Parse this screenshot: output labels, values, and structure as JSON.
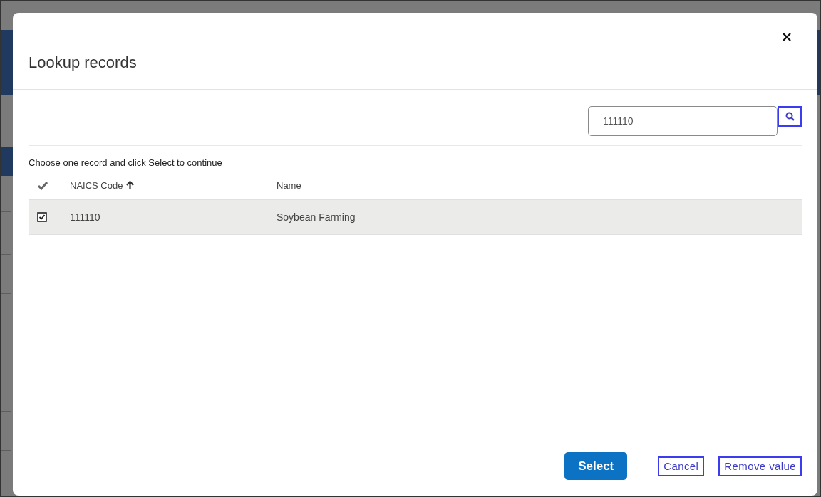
{
  "dialog": {
    "title": "Lookup records"
  },
  "search": {
    "value": "111110"
  },
  "instruction": "Choose one record and click Select to continue",
  "columns": [
    {
      "label": "NAICS Code",
      "sorted": true
    },
    {
      "label": "Name",
      "sorted": false
    }
  ],
  "rows": [
    {
      "selected": true,
      "checked": true,
      "cells": [
        "111110",
        "Soybean Farming"
      ]
    }
  ],
  "buttons": [
    {
      "label": "Select",
      "kind": "primary"
    },
    {
      "label": "Cancel",
      "kind": "outline"
    },
    {
      "label": "Remove value",
      "kind": "outline"
    }
  ]
}
